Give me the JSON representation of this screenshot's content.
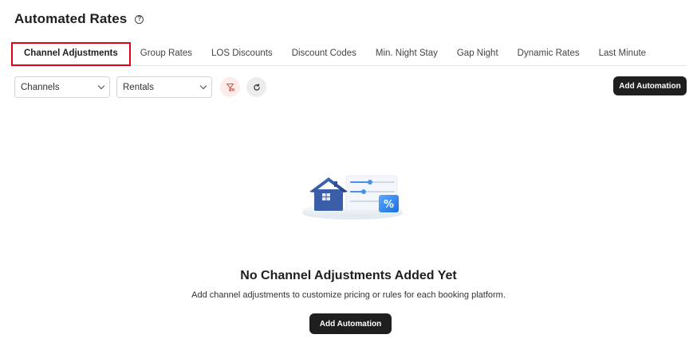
{
  "page": {
    "title": "Automated Rates",
    "help_icon": "question-circle-icon"
  },
  "tabs": [
    {
      "label": "Channel Adjustments",
      "active": true
    },
    {
      "label": "Group Rates"
    },
    {
      "label": "LOS Discounts"
    },
    {
      "label": "Discount Codes"
    },
    {
      "label": "Min. Night Stay"
    },
    {
      "label": "Gap Night"
    },
    {
      "label": "Dynamic Rates"
    },
    {
      "label": "Last Minute"
    }
  ],
  "filters": {
    "channels": {
      "value": "Channels"
    },
    "rentals": {
      "value": "Rentals"
    },
    "clear_filter_icon": "filter-clear-icon",
    "refresh_icon": "refresh-icon"
  },
  "toolbar": {
    "add_label": "Add Automation"
  },
  "empty_state": {
    "title": "No Channel Adjustments Added Yet",
    "description": "Add channel adjustments to customize pricing or rules for each booking platform.",
    "add_label": "Add Automation",
    "illustration_icon": "house-percent-illustration"
  },
  "colors": {
    "active_tab_border": "#e3001b",
    "button_dark": "#1f1f1f",
    "filter_btn_bg": "#fdecea"
  }
}
